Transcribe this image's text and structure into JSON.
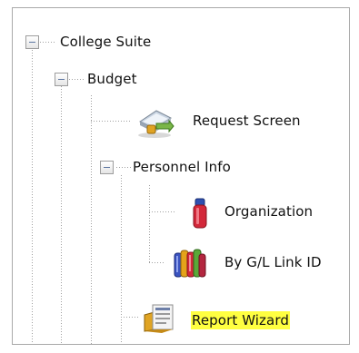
{
  "tree": {
    "nodes": [
      {
        "label": "College Suite",
        "expanded": true
      },
      {
        "label": "Budget",
        "expanded": true
      },
      {
        "label": "Request Screen",
        "icon": "request-screen-icon"
      },
      {
        "label": "Personnel Info",
        "expanded": true
      },
      {
        "label": "Organization",
        "icon": "organization-icon"
      },
      {
        "label": "By G/L Link ID",
        "icon": "gl-link-icon"
      },
      {
        "label": "Report Wizard",
        "icon": "report-wizard-icon",
        "selected": true
      }
    ]
  },
  "colors": {
    "selection_highlight": "#ffff41",
    "frame_border": "#a9a9a9",
    "tree_line": "#a0a0a0"
  }
}
